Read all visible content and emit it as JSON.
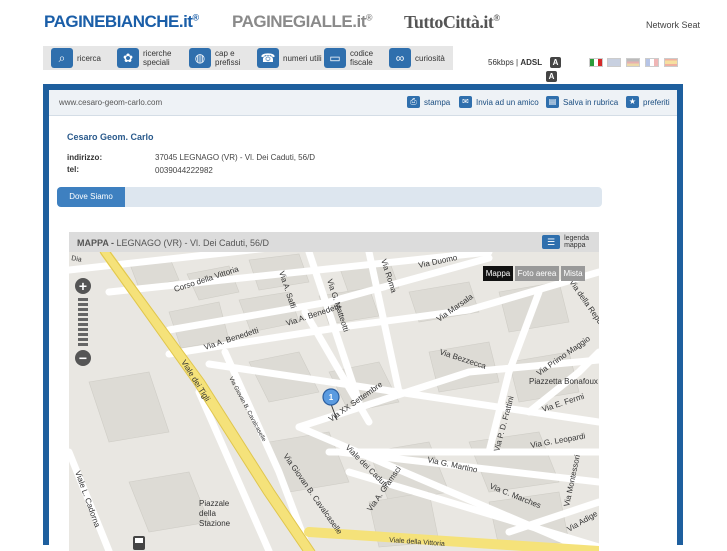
{
  "header": {
    "logos": {
      "paginebianche": "PAGINEBIANCHE.it",
      "paginegialle": "PAGINEGIALLE.it",
      "tuttocitta": "TuttoCittà.it"
    },
    "network_link": "Network Seat"
  },
  "nav": {
    "items": [
      {
        "label": "ricerca",
        "icon": "search-icon"
      },
      {
        "label": "ricerche speciali",
        "icon": "puzzle-icon"
      },
      {
        "label": "cap e prefissi",
        "icon": "globe-icon"
      },
      {
        "label": "numeri utili",
        "icon": "phone-icon"
      },
      {
        "label": "codice fiscale",
        "icon": "card-icon"
      },
      {
        "label": "curiosità",
        "icon": "chain-icon"
      }
    ],
    "speed_label": "56kbps",
    "adsl_label": "ADSL",
    "font_badge_a": "A",
    "font_badge_b": "A"
  },
  "toolbar": {
    "url": "www.cesaro-geom-carlo.com",
    "stampa": "stampa",
    "invia": "Invia ad un amico",
    "salva": "Salva in rubrica",
    "preferiti": "preferiti"
  },
  "listing": {
    "name": "Cesaro Geom. Carlo",
    "address_label": "indirizzo:",
    "address_value": "37045 LEGNAGO (VR) - Vl. Dei Caduti, 56/D",
    "tel_label": "tel:",
    "tel_value": "0039044222982"
  },
  "tabs": {
    "dove_siamo": "Dove Siamo"
  },
  "map": {
    "title": "MAPPA -",
    "location": "LEGNAGO (VR) - Vl. Dei Caduti, 56/D",
    "legend_line1": "legenda",
    "legend_line2": "mappa",
    "type_mappa": "Mappa",
    "type_foto": "Foto aerea",
    "type_mista": "Mista",
    "marker_label": "1",
    "streets": {
      "vittoria": "Corso della Vittoria",
      "saffi": "Via A. Saffi",
      "matteotti": "Via G. Matteotti",
      "roma": "Via Roma",
      "duomo": "Via Duomo",
      "marsala": "Via Marsala",
      "repubblica": "Via della Repubblica",
      "benedetti1": "Via A. Benedetti",
      "benedetti2": "Via A. Benedetti",
      "bezzecca": "Via Bezzecca",
      "maggio": "Via Primo Maggio",
      "bonafoux": "Piazzetta Bonafoux",
      "fermi": "Via E. Fermi",
      "tigli": "Viale dei Tigli",
      "cavalcaselle1": "Via Giovan B. Cavalcaselle",
      "settembre": "Via XX Settembre",
      "frattini": "Via P. D. Frattini",
      "leopardi": "Via G. Leopardi",
      "caduti": "Viale dei Caduti",
      "gramsci": "Via A. Gramsci",
      "martino": "Via G. Martino",
      "marches": "Via C. Marches",
      "montessori": "Via Montessori",
      "adige": "Via Adige",
      "cadorna": "Viale L. Cadorna",
      "cavalcaselle2": "Via Giovan B. Cavalcaselle",
      "stazione": [
        "Piazzale",
        "della",
        "Stazione"
      ],
      "vitt_bottom": "Viale della Vittoria",
      "dx": "Dia"
    }
  }
}
